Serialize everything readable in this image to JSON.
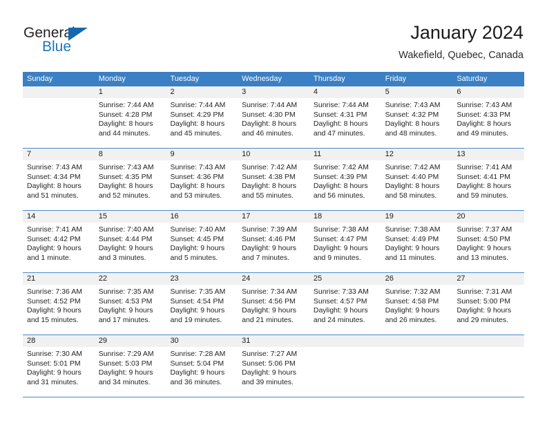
{
  "brand": {
    "name_part1": "General",
    "name_part2": "Blue",
    "color_dark": "#231f20",
    "color_blue": "#1b75bb"
  },
  "header": {
    "title": "January 2024",
    "subtitle": "Wakefield, Quebec, Canada"
  },
  "theme": {
    "header_row_bg": "#3b7fc4",
    "header_row_text": "#ffffff",
    "row_separator": "#4b8ac9",
    "day_number_band": "#f1f1f1",
    "cell_bg": "#ffffff",
    "body_text": "#232323"
  },
  "weekdays": [
    "Sunday",
    "Monday",
    "Tuesday",
    "Wednesday",
    "Thursday",
    "Friday",
    "Saturday"
  ],
  "weeks": [
    [
      {
        "day": "",
        "lines": []
      },
      {
        "day": "1",
        "lines": [
          "Sunrise: 7:44 AM",
          "Sunset: 4:28 PM",
          "Daylight: 8 hours",
          "and 44 minutes."
        ]
      },
      {
        "day": "2",
        "lines": [
          "Sunrise: 7:44 AM",
          "Sunset: 4:29 PM",
          "Daylight: 8 hours",
          "and 45 minutes."
        ]
      },
      {
        "day": "3",
        "lines": [
          "Sunrise: 7:44 AM",
          "Sunset: 4:30 PM",
          "Daylight: 8 hours",
          "and 46 minutes."
        ]
      },
      {
        "day": "4",
        "lines": [
          "Sunrise: 7:44 AM",
          "Sunset: 4:31 PM",
          "Daylight: 8 hours",
          "and 47 minutes."
        ]
      },
      {
        "day": "5",
        "lines": [
          "Sunrise: 7:43 AM",
          "Sunset: 4:32 PM",
          "Daylight: 8 hours",
          "and 48 minutes."
        ]
      },
      {
        "day": "6",
        "lines": [
          "Sunrise: 7:43 AM",
          "Sunset: 4:33 PM",
          "Daylight: 8 hours",
          "and 49 minutes."
        ]
      }
    ],
    [
      {
        "day": "7",
        "lines": [
          "Sunrise: 7:43 AM",
          "Sunset: 4:34 PM",
          "Daylight: 8 hours",
          "and 51 minutes."
        ]
      },
      {
        "day": "8",
        "lines": [
          "Sunrise: 7:43 AM",
          "Sunset: 4:35 PM",
          "Daylight: 8 hours",
          "and 52 minutes."
        ]
      },
      {
        "day": "9",
        "lines": [
          "Sunrise: 7:43 AM",
          "Sunset: 4:36 PM",
          "Daylight: 8 hours",
          "and 53 minutes."
        ]
      },
      {
        "day": "10",
        "lines": [
          "Sunrise: 7:42 AM",
          "Sunset: 4:38 PM",
          "Daylight: 8 hours",
          "and 55 minutes."
        ]
      },
      {
        "day": "11",
        "lines": [
          "Sunrise: 7:42 AM",
          "Sunset: 4:39 PM",
          "Daylight: 8 hours",
          "and 56 minutes."
        ]
      },
      {
        "day": "12",
        "lines": [
          "Sunrise: 7:42 AM",
          "Sunset: 4:40 PM",
          "Daylight: 8 hours",
          "and 58 minutes."
        ]
      },
      {
        "day": "13",
        "lines": [
          "Sunrise: 7:41 AM",
          "Sunset: 4:41 PM",
          "Daylight: 8 hours",
          "and 59 minutes."
        ]
      }
    ],
    [
      {
        "day": "14",
        "lines": [
          "Sunrise: 7:41 AM",
          "Sunset: 4:42 PM",
          "Daylight: 9 hours",
          "and 1 minute."
        ]
      },
      {
        "day": "15",
        "lines": [
          "Sunrise: 7:40 AM",
          "Sunset: 4:44 PM",
          "Daylight: 9 hours",
          "and 3 minutes."
        ]
      },
      {
        "day": "16",
        "lines": [
          "Sunrise: 7:40 AM",
          "Sunset: 4:45 PM",
          "Daylight: 9 hours",
          "and 5 minutes."
        ]
      },
      {
        "day": "17",
        "lines": [
          "Sunrise: 7:39 AM",
          "Sunset: 4:46 PM",
          "Daylight: 9 hours",
          "and 7 minutes."
        ]
      },
      {
        "day": "18",
        "lines": [
          "Sunrise: 7:38 AM",
          "Sunset: 4:47 PM",
          "Daylight: 9 hours",
          "and 9 minutes."
        ]
      },
      {
        "day": "19",
        "lines": [
          "Sunrise: 7:38 AM",
          "Sunset: 4:49 PM",
          "Daylight: 9 hours",
          "and 11 minutes."
        ]
      },
      {
        "day": "20",
        "lines": [
          "Sunrise: 7:37 AM",
          "Sunset: 4:50 PM",
          "Daylight: 9 hours",
          "and 13 minutes."
        ]
      }
    ],
    [
      {
        "day": "21",
        "lines": [
          "Sunrise: 7:36 AM",
          "Sunset: 4:52 PM",
          "Daylight: 9 hours",
          "and 15 minutes."
        ]
      },
      {
        "day": "22",
        "lines": [
          "Sunrise: 7:35 AM",
          "Sunset: 4:53 PM",
          "Daylight: 9 hours",
          "and 17 minutes."
        ]
      },
      {
        "day": "23",
        "lines": [
          "Sunrise: 7:35 AM",
          "Sunset: 4:54 PM",
          "Daylight: 9 hours",
          "and 19 minutes."
        ]
      },
      {
        "day": "24",
        "lines": [
          "Sunrise: 7:34 AM",
          "Sunset: 4:56 PM",
          "Daylight: 9 hours",
          "and 21 minutes."
        ]
      },
      {
        "day": "25",
        "lines": [
          "Sunrise: 7:33 AM",
          "Sunset: 4:57 PM",
          "Daylight: 9 hours",
          "and 24 minutes."
        ]
      },
      {
        "day": "26",
        "lines": [
          "Sunrise: 7:32 AM",
          "Sunset: 4:58 PM",
          "Daylight: 9 hours",
          "and 26 minutes."
        ]
      },
      {
        "day": "27",
        "lines": [
          "Sunrise: 7:31 AM",
          "Sunset: 5:00 PM",
          "Daylight: 9 hours",
          "and 29 minutes."
        ]
      }
    ],
    [
      {
        "day": "28",
        "lines": [
          "Sunrise: 7:30 AM",
          "Sunset: 5:01 PM",
          "Daylight: 9 hours",
          "and 31 minutes."
        ]
      },
      {
        "day": "29",
        "lines": [
          "Sunrise: 7:29 AM",
          "Sunset: 5:03 PM",
          "Daylight: 9 hours",
          "and 34 minutes."
        ]
      },
      {
        "day": "30",
        "lines": [
          "Sunrise: 7:28 AM",
          "Sunset: 5:04 PM",
          "Daylight: 9 hours",
          "and 36 minutes."
        ]
      },
      {
        "day": "31",
        "lines": [
          "Sunrise: 7:27 AM",
          "Sunset: 5:06 PM",
          "Daylight: 9 hours",
          "and 39 minutes."
        ]
      },
      {
        "day": "",
        "lines": []
      },
      {
        "day": "",
        "lines": []
      },
      {
        "day": "",
        "lines": []
      }
    ]
  ]
}
